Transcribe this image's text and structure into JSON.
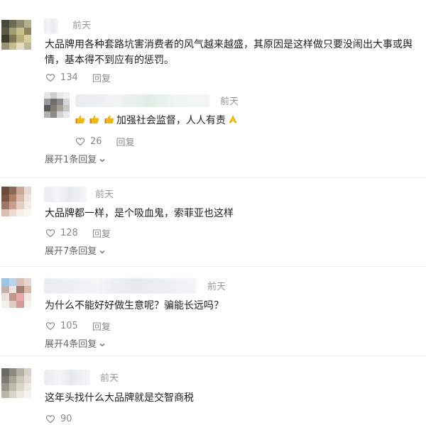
{
  "comments": [
    {
      "date": "前天",
      "text": "大品牌用各种套路坑害消费者的风气越来越盛，其原因是这样做只要没闹出大事或舆情，基本得不到应有的惩罚。",
      "likes": "134",
      "reply_label": "回复",
      "expand_label": "展开1条回复",
      "reply": {
        "date": "前天",
        "text": "加强社会监督，人人有责",
        "likes": "26",
        "reply_label": "回复"
      }
    },
    {
      "date": "前天",
      "text": "大品牌都一样，是个吸血鬼，索菲亚也这样",
      "likes": "128",
      "reply_label": "回复",
      "expand_label": "展开7条回复"
    },
    {
      "date": "前天",
      "text": "为什么不能好好做生意呢？骗能长远吗？",
      "likes": "105",
      "reply_label": "回复",
      "expand_label": "展开4条回复"
    },
    {
      "date": "前天",
      "text": "这年头找什么大品牌就是交智商税",
      "likes": "90"
    }
  ],
  "icons": {
    "like": "thumbs-up-outline-icon",
    "expand": "chevron-down-icon",
    "emoji_thumbs": "thumbs-up-emoji-icon",
    "emoji_pray": "folded-hands-emoji-icon"
  },
  "colors": {
    "text": "#222222",
    "meta": "#9a9a9a",
    "action": "#8a8a8a"
  }
}
